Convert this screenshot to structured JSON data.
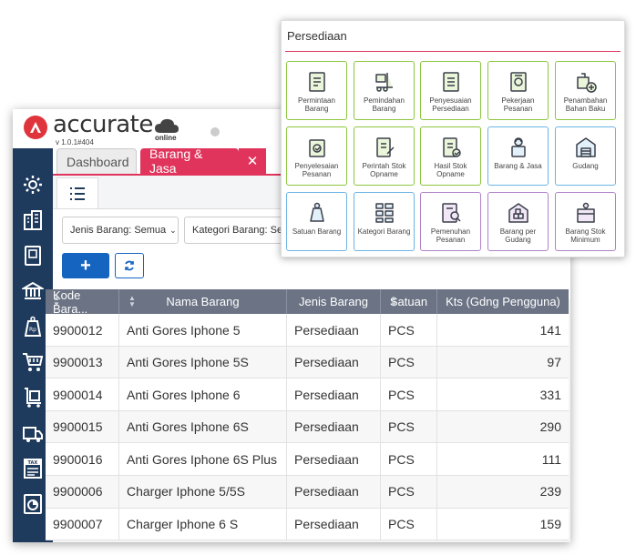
{
  "app": {
    "logo_text": "accurate",
    "logo_sub": "online",
    "version": "v 1.0.1#404"
  },
  "sidebar_icons": [
    "gear-icon",
    "building-icon",
    "book-icon",
    "bank-icon",
    "price-tag-icon",
    "cart-icon",
    "trolley-icon",
    "truck-icon",
    "tax-icon",
    "report-icon"
  ],
  "tabs": [
    {
      "label": "Dashboard",
      "active": false
    },
    {
      "label": "Barang & Jasa",
      "active": true
    }
  ],
  "filters": {
    "jenis_barang": "Jenis Barang: Semua",
    "kategori_barang": "Kategori Barang: Se"
  },
  "toolbar": {
    "add_label": "+"
  },
  "table": {
    "headers": [
      "Kode Bara...",
      "Nama Barang",
      "Jenis Barang",
      "Satuan",
      "Kts (Gdng Pengguna)"
    ],
    "rows": [
      [
        "9900012",
        "Anti Gores Iphone 5",
        "Persediaan",
        "PCS",
        "141"
      ],
      [
        "9900013",
        "Anti Gores Iphone 5S",
        "Persediaan",
        "PCS",
        "97"
      ],
      [
        "9900014",
        "Anti Gores Iphone 6",
        "Persediaan",
        "PCS",
        "331"
      ],
      [
        "9900015",
        "Anti Gores Iphone 6S",
        "Persediaan",
        "PCS",
        "290"
      ],
      [
        "9900016",
        "Anti Gores Iphone 6S Plus",
        "Persediaan",
        "PCS",
        "111"
      ],
      [
        "9900006",
        "Charger Iphone 5/5S",
        "Persediaan",
        "PCS",
        "239"
      ],
      [
        "9900007",
        "Charger Iphone 6 S",
        "Persediaan",
        "PCS",
        "159"
      ]
    ]
  },
  "popup": {
    "title": "Persediaan",
    "tiles": [
      {
        "label": "Permintaan Barang",
        "icon": "request-doc-icon",
        "color": "#8cc63f"
      },
      {
        "label": "Pemindahan Barang",
        "icon": "forklift-icon",
        "color": "#8cc63f"
      },
      {
        "label": "Penyesuaian Persediaan",
        "icon": "adjust-doc-icon",
        "color": "#8cc63f"
      },
      {
        "label": "Pekerjaan Pesanan",
        "icon": "work-order-icon",
        "color": "#8cc63f"
      },
      {
        "label": "Penambahan Bahan Baku",
        "icon": "add-material-icon",
        "color": "#8cc63f"
      },
      {
        "label": "Penyelesaian Pesanan",
        "icon": "complete-order-icon",
        "color": "#8cc63f"
      },
      {
        "label": "Perintah Stok Opname",
        "icon": "stock-order-icon",
        "color": "#8cc63f"
      },
      {
        "label": "Hasil Stok Opname",
        "icon": "stock-result-icon",
        "color": "#8cc63f"
      },
      {
        "label": "Barang & Jasa",
        "icon": "item-service-icon",
        "color": "#6cb4e4"
      },
      {
        "label": "Gudang",
        "icon": "warehouse-icon",
        "color": "#6cb4e4"
      },
      {
        "label": "Satuan Barang",
        "icon": "weight-kg-icon",
        "color": "#6cb4e4"
      },
      {
        "label": "Kategori Barang",
        "icon": "category-icon",
        "color": "#6cb4e4"
      },
      {
        "label": "Pemenuhan Pesanan",
        "icon": "fulfillment-icon",
        "color": "#b083c9"
      },
      {
        "label": "Barang per Gudang",
        "icon": "items-warehouse-icon",
        "color": "#b083c9"
      },
      {
        "label": "Barang Stok Minimum",
        "icon": "min-stock-icon",
        "color": "#b083c9"
      }
    ]
  },
  "colors": {
    "accent": "#e0345c",
    "sidebar": "#1e3a5c",
    "primary_button": "#1565c0",
    "table_header": "#6b7384"
  }
}
